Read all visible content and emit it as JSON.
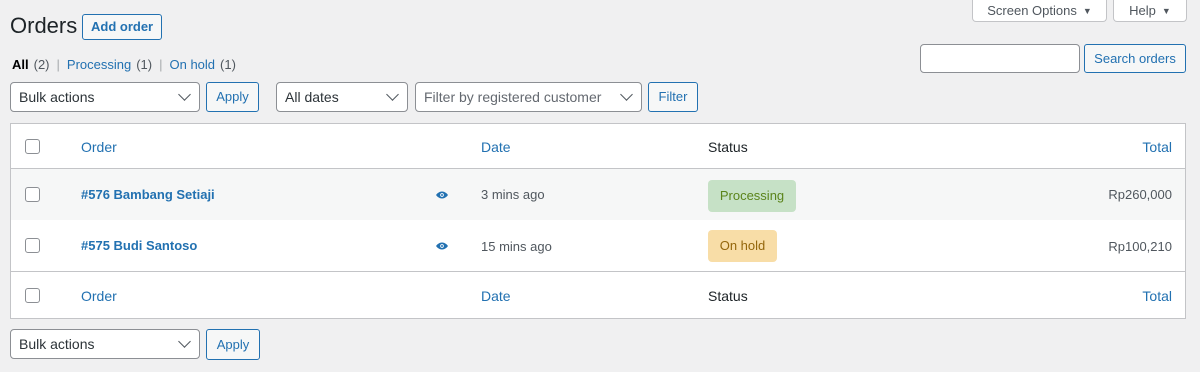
{
  "header": {
    "title": "Orders",
    "add_button": "Add order",
    "screen_options": "Screen Options",
    "help": "Help"
  },
  "filters_links": {
    "all_label": "All",
    "all_count": "(2)",
    "processing_label": "Processing",
    "processing_count": "(1)",
    "onhold_label": "On hold",
    "onhold_count": "(1)"
  },
  "search": {
    "value": "",
    "button": "Search orders"
  },
  "tablenav": {
    "bulk_actions": "Bulk actions",
    "apply": "Apply",
    "dates": "All dates",
    "customer_placeholder": "Filter by registered customer",
    "filter": "Filter"
  },
  "table": {
    "columns": {
      "order": "Order",
      "date": "Date",
      "status": "Status",
      "total": "Total"
    },
    "rows": [
      {
        "order": "#576 Bambang Setiaji",
        "date": "3 mins ago",
        "status": "Processing",
        "total": "Rp260,000"
      },
      {
        "order": "#575 Budi Santoso",
        "date": "15 mins ago",
        "status": "On hold",
        "total": "Rp100,210"
      }
    ]
  },
  "icons": {
    "preview": "eye-icon",
    "dropdown": "chevron-down-icon"
  },
  "colors": {
    "accent": "#2271b1",
    "processing_bg": "#c6e1c6",
    "processing_text": "#5b841b",
    "onhold_bg": "#f8dda7",
    "onhold_text": "#94660c"
  }
}
